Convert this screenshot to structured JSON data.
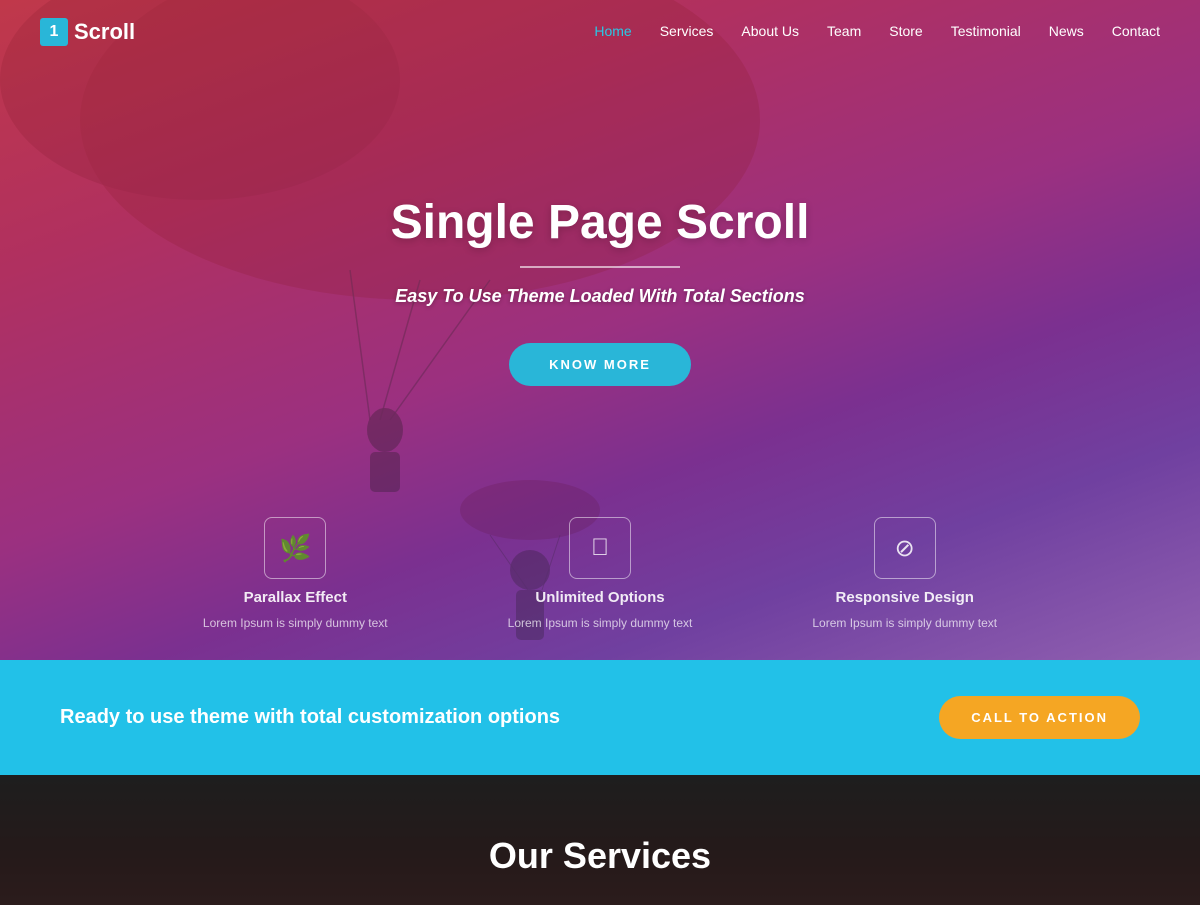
{
  "brand": {
    "badge": "1",
    "name": "Scroll"
  },
  "nav": {
    "links": [
      {
        "label": "Home",
        "active": true
      },
      {
        "label": "Services",
        "active": false
      },
      {
        "label": "About Us",
        "active": false
      },
      {
        "label": "Team",
        "active": false
      },
      {
        "label": "Store",
        "active": false
      },
      {
        "label": "Testimonial",
        "active": false
      },
      {
        "label": "News",
        "active": false
      },
      {
        "label": "Contact",
        "active": false
      }
    ]
  },
  "hero": {
    "title": "Single Page Scroll",
    "subtitle": "Easy To Use Theme Loaded With Total Sections",
    "cta_button": "KNOW MORE"
  },
  "features": [
    {
      "icon": "🌿",
      "title": "Parallax Effect",
      "desc": "Lorem Ipsum is simply dummy text"
    },
    {
      "icon": "",
      "title": "Unlimited Options",
      "desc": "Lorem Ipsum is simply dummy text"
    },
    {
      "icon": "⊘",
      "title": "Responsive Design",
      "desc": "Lorem Ipsum is simply dummy text"
    }
  ],
  "cta_band": {
    "text": "Ready to use theme with total customization options",
    "button": "CALL TO ACTION"
  },
  "services_section": {
    "title": "Our Services"
  }
}
